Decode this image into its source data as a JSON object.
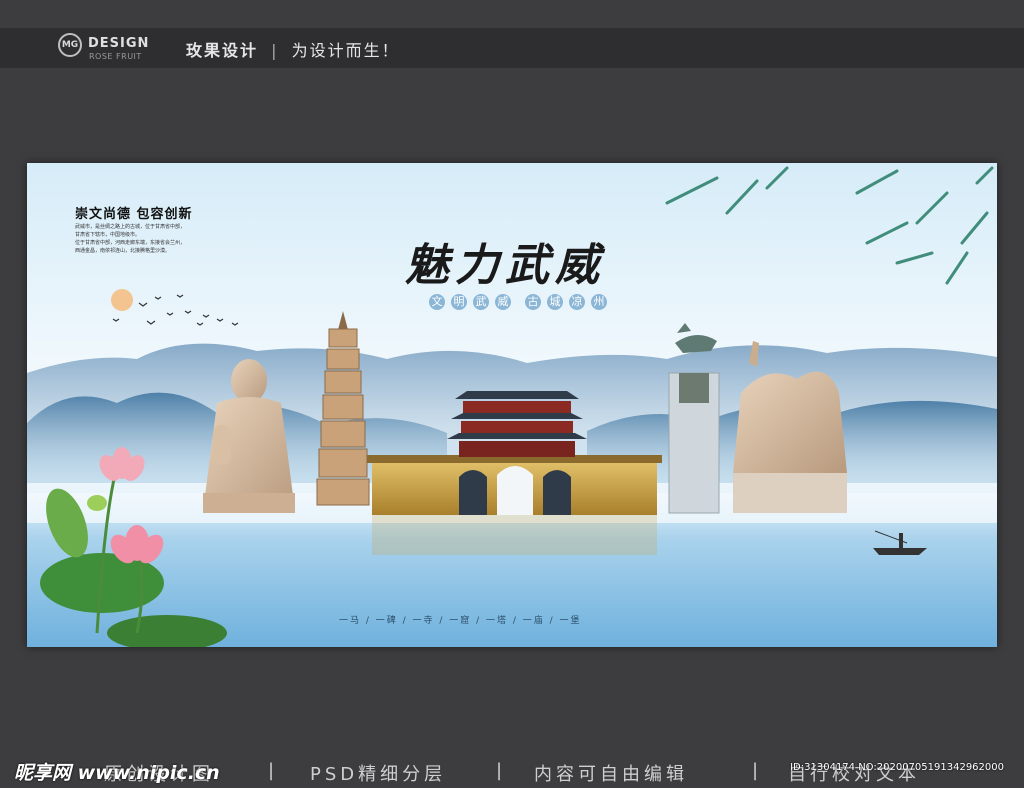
{
  "header": {
    "logo_mark": "MG",
    "logo_title": "DESIGN",
    "logo_subtitle": "ROSE FRUIT",
    "brand": "玫果设计",
    "separator": "|",
    "tagline": "为设计而生！"
  },
  "poster": {
    "slogan": "崇文尚德  包容创新",
    "description": [
      "武威市，是丝绸之路上的古城，位于甘肃省中部，",
      "甘肃省下辖市，中国地级市。",
      "位于甘肃省中部，河西走廊东端，东接省会兰州，",
      "西通金昌，南依祁连山，北接腾格里沙漠。"
    ],
    "title": "魅力武威",
    "pills_left": [
      "文",
      "明",
      "武",
      "威"
    ],
    "pills_right": [
      "古",
      "城",
      "凉",
      "州"
    ],
    "bottom_line": "一马 / 一碑 / 一寺 / 一窟 / 一塔 / 一庙 / 一堡",
    "colors": {
      "sky_top": "#d6ecf8",
      "water": "#84bfe3",
      "mountain": "#7fa8c8",
      "gate": "#c9a24a"
    }
  },
  "footer": {
    "items": [
      "原创设计图",
      "PSD精细分层",
      "内容可自由编辑",
      "自行校对文本"
    ],
    "separator": "|",
    "watermark_left": "昵享网 www.nipic.cn",
    "watermark_right": "ID:31304174 NO:20200705191342962000"
  }
}
